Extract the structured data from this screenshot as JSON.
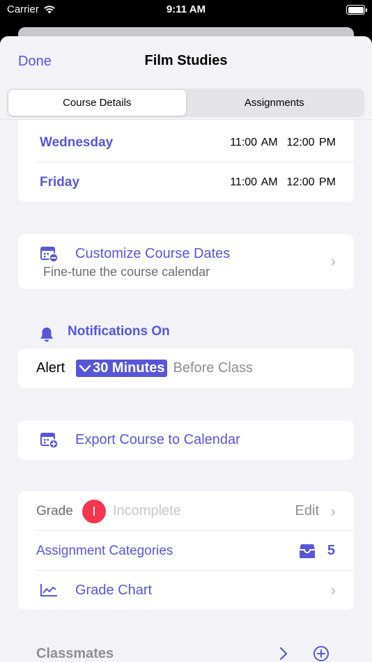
{
  "status": {
    "carrier": "Carrier",
    "time": "9:11 AM"
  },
  "nav": {
    "done": "Done",
    "title": "Film Studies"
  },
  "tabs": [
    {
      "label": "Course Details",
      "selected": true
    },
    {
      "label": "Assignments",
      "selected": false
    }
  ],
  "schedule": [
    {
      "day": "Wednesday",
      "start": "11:00 AM",
      "end": "12:00 PM"
    },
    {
      "day": "Friday",
      "start": "11:00 AM",
      "end": "12:00 PM"
    }
  ],
  "customize": {
    "title": "Customize Course Dates",
    "subtitle": "Fine-tune the course calendar"
  },
  "notifications": {
    "label": "Notifications On",
    "alert_label": "Alert",
    "alert_value": "30 Minutes",
    "alert_suffix": "Before Class"
  },
  "export": {
    "label": "Export Course to Calendar"
  },
  "grade": {
    "label": "Grade",
    "badge": "I",
    "value": "Incomplete",
    "edit": "Edit"
  },
  "categories": {
    "label": "Assignment Categories",
    "count": "5"
  },
  "chart": {
    "label": "Grade Chart"
  },
  "classmates": {
    "label": "Classmates"
  },
  "colors": {
    "accent": "#5856d6",
    "grade_badge": "#f2374f"
  }
}
